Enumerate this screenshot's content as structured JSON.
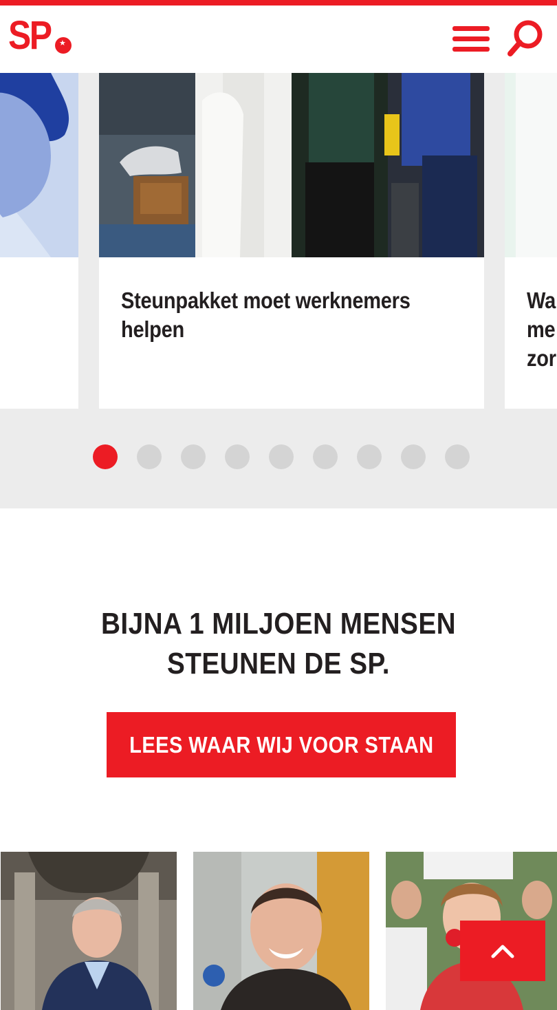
{
  "brand": {
    "logo_text": "SP",
    "accent": "#ec1c24"
  },
  "header": {
    "menu_icon": "hamburger-menu-icon",
    "search_icon": "search-icon"
  },
  "carousel": {
    "cards": [
      {
        "title": ""
      },
      {
        "title": "Steunpakket moet werknemers helpen"
      },
      {
        "title": "Wa\nme\nzor"
      }
    ],
    "dots": 9,
    "active_index": 0
  },
  "support": {
    "heading": "BIJNA 1 MILJOEN MENSEN STEUNEN DE SP.",
    "cta_label": "LEES WAAR WIJ VOOR STAAN"
  },
  "people": [
    {
      "icon": "person-photo"
    },
    {
      "icon": "person-photo"
    },
    {
      "icon": "person-photo"
    }
  ],
  "back_to_top": {
    "icon": "chevron-up-icon"
  }
}
